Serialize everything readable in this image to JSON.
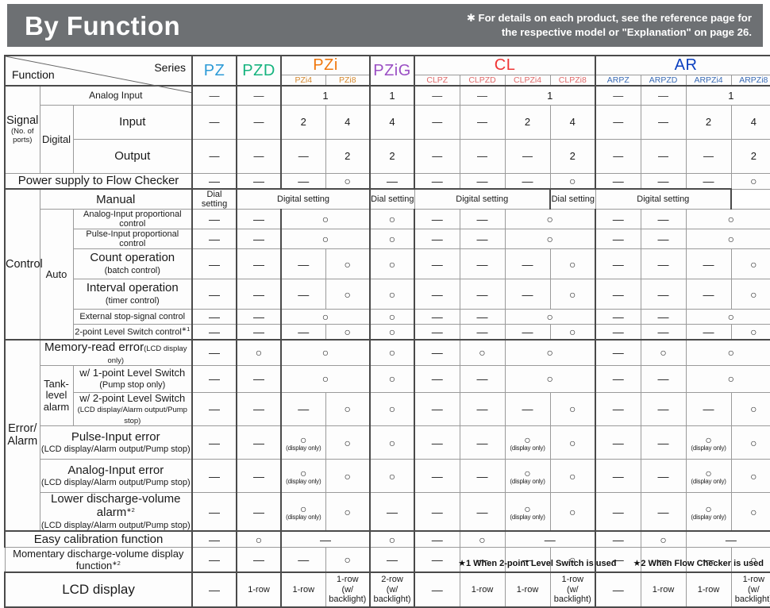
{
  "banner": {
    "title": "By Function",
    "note": "✱ For details on each product, see the reference page for\nthe respective model or \"Explanation\" on page 26."
  },
  "corner": {
    "series_label": "Series",
    "function_label": "Function"
  },
  "series_groups": [
    {
      "name": "PZ",
      "subs": []
    },
    {
      "name": "PZD",
      "subs": []
    },
    {
      "name": "PZi",
      "subs": [
        "PZi4",
        "PZi8"
      ]
    },
    {
      "name": "PZiG",
      "subs": []
    },
    {
      "name": "CL",
      "subs": [
        "CLPZ",
        "CLPZD",
        "CLPZi4",
        "CLPZi8"
      ]
    },
    {
      "name": "AR",
      "subs": [
        "ARPZ",
        "ARPZD",
        "ARPZi4",
        "ARPZi8"
      ]
    }
  ],
  "columns": [
    "PZ",
    "PZD",
    "PZi4",
    "PZi8",
    "PZiG",
    "CLPZ",
    "CLPZD",
    "CLPZi4",
    "CLPZi8",
    "ARPZ",
    "ARPZD",
    "ARPZi4",
    "ARPZi8"
  ],
  "rows": {
    "signal_group": "Signal",
    "signal_group_sub": "(No. of ports)",
    "digital_group": "Digital",
    "analog_input": "Analog Input",
    "digital_input": "Input",
    "digital_output": "Output",
    "power_supply": "Power supply to Flow Checker",
    "control_group": "Control",
    "manual": "Manual",
    "auto": "Auto",
    "analog_prop": "Analog-Input proportional control",
    "pulse_prop": "Pulse-Input proportional control",
    "count_op": "Count operation",
    "count_op_sub": "(batch control)",
    "interval_op": "Interval operation",
    "interval_op_sub": "(timer control)",
    "external_stop": "External stop-signal control",
    "two_point_level": "2-point Level Switch control",
    "two_point_level_sup": "∗1",
    "error_group": "Error/\nAlarm",
    "memory_read": "Memory-read error",
    "memory_read_sub": "(LCD display only)",
    "tank_level": "Tank-\nlevel\nalarm",
    "tank_1pt": "w/ 1-point Level Switch",
    "tank_1pt_sub": "(Pump stop only)",
    "tank_2pt": "w/ 2-point Level Switch",
    "tank_2pt_sub": "(LCD display/Alarm output/Pump stop)",
    "pulse_err": "Pulse-Input error",
    "pulse_err_sub": "(LCD display/Alarm output/Pump stop)",
    "analog_err": "Analog-Input error",
    "analog_err_sub": "(LCD display/Alarm output/Pump stop)",
    "lower_alarm": "Lower discharge-volume alarm",
    "lower_alarm_sup": "∗2",
    "lower_alarm_sub": "(LCD display/Alarm output/Pump stop)",
    "easy_cal": "Easy calibration function",
    "momentary": "Momentary discharge-volume display function",
    "momentary_sup": "∗2",
    "lcd_display": "LCD display"
  },
  "values": {
    "analog_input": {
      "PZ": "—",
      "PZD": "—",
      "PZi": "1",
      "PZiG": "1",
      "CLPZ": "—",
      "CLPZD": "—",
      "CLPZi": "1",
      "ARPZ": "—",
      "ARPZD": "—",
      "ARPZi": "1"
    },
    "digital_input": [
      "—",
      "—",
      "2",
      "4",
      "4",
      "—",
      "—",
      "2",
      "4",
      "—",
      "—",
      "2",
      "4"
    ],
    "digital_output": [
      "—",
      "—",
      "—",
      "2",
      "2",
      "—",
      "—",
      "—",
      "2",
      "—",
      "—",
      "—",
      "2"
    ],
    "power_supply": [
      "—",
      "—",
      "—",
      "○",
      "—",
      "—",
      "—",
      "—",
      "○",
      "—",
      "—",
      "—",
      "○"
    ],
    "manual": {
      "dial": "Dial setting",
      "digital": "Digital setting"
    },
    "analog_prop": {
      "PZ": "—",
      "PZD": "—",
      "PZi": "○",
      "PZiG": "○",
      "CLPZ": "—",
      "CLPZD": "—",
      "CLPZi": "○",
      "ARPZ": "—",
      "ARPZD": "—",
      "ARPZi": "○"
    },
    "pulse_prop": {
      "PZ": "—",
      "PZD": "—",
      "PZi": "○",
      "PZiG": "○",
      "CLPZ": "—",
      "CLPZD": "—",
      "CLPZi": "○",
      "ARPZ": "—",
      "ARPZD": "—",
      "ARPZi": "○"
    },
    "count_op": [
      "—",
      "—",
      "—",
      "○",
      "○",
      "—",
      "—",
      "—",
      "○",
      "—",
      "—",
      "—",
      "○"
    ],
    "interval_op": [
      "—",
      "—",
      "—",
      "○",
      "○",
      "—",
      "—",
      "—",
      "○",
      "—",
      "—",
      "—",
      "○"
    ],
    "external_stop": {
      "PZ": "—",
      "PZD": "—",
      "PZi": "○",
      "PZiG": "○",
      "CLPZ": "—",
      "CLPZD": "—",
      "CLPZi": "○",
      "ARPZ": "—",
      "ARPZD": "—",
      "ARPZi": "○"
    },
    "two_point_level": [
      "—",
      "—",
      "—",
      "○",
      "○",
      "—",
      "—",
      "—",
      "○",
      "—",
      "—",
      "—",
      "○"
    ],
    "memory_read": {
      "PZ": "—",
      "PZD": "○",
      "PZi": "○",
      "PZiG": "○",
      "CLPZ": "—",
      "CLPZD": "○",
      "CLPZi": "○",
      "ARPZ": "—",
      "ARPZD": "○",
      "ARPZi": "○"
    },
    "tank_1pt": {
      "PZ": "—",
      "PZD": "—",
      "PZi": "○",
      "PZiG": "○",
      "CLPZ": "—",
      "CLPZD": "—",
      "CLPZi": "○",
      "ARPZ": "—",
      "ARPZD": "—",
      "ARPZi": "○"
    },
    "tank_2pt": [
      "—",
      "—",
      "—",
      "○",
      "○",
      "—",
      "—",
      "—",
      "○",
      "—",
      "—",
      "—",
      "○"
    ],
    "pulse_err": [
      "—",
      "—",
      "○",
      "○",
      "○",
      "—",
      "—",
      "○",
      "○",
      "—",
      "—",
      "○",
      "○"
    ],
    "pulse_err_display_only": [
      "",
      "",
      "(display only)",
      "",
      "",
      "",
      "",
      "(display only)",
      "",
      "",
      "",
      "(display only)",
      ""
    ],
    "analog_err": [
      "—",
      "—",
      "○",
      "○",
      "○",
      "—",
      "—",
      "○",
      "○",
      "—",
      "—",
      "○",
      "○"
    ],
    "analog_err_display_only": [
      "",
      "",
      "(display only)",
      "",
      "",
      "",
      "",
      "(display only)",
      "",
      "",
      "",
      "(display only)",
      ""
    ],
    "lower_alarm": [
      "—",
      "—",
      "○",
      "○",
      "—",
      "—",
      "—",
      "○",
      "○",
      "—",
      "—",
      "○",
      "○"
    ],
    "lower_alarm_display_only": [
      "",
      "",
      "(display only)",
      "",
      "",
      "",
      "",
      "(display only)",
      "",
      "",
      "",
      "(display only)",
      ""
    ],
    "easy_cal": {
      "PZ": "—",
      "PZD": "○",
      "PZi": "—",
      "PZiG": "○",
      "CLPZ": "—",
      "CLPZD": "○",
      "CLPZi": "—",
      "ARPZ": "—",
      "ARPZD": "○",
      "ARPZi": "—"
    },
    "momentary": [
      "—",
      "—",
      "—",
      "○",
      "—",
      "—",
      "—",
      "—",
      "○",
      "—",
      "—",
      "—",
      "○"
    ],
    "lcd_display": [
      "—",
      "1-row",
      "1-row",
      "1-row",
      "2-row",
      "—",
      "1-row",
      "1-row",
      "1-row",
      "—",
      "1-row",
      "1-row",
      "1-row"
    ],
    "lcd_display_sub": [
      "",
      "",
      "",
      "(w/ backlight)",
      "(w/ backlight)",
      "",
      "",
      "",
      "(w/ backlight)",
      "",
      "",
      "",
      "(w/ backlight)"
    ]
  },
  "footnotes": {
    "fn1": "★1 When 2-point Level Switch is used",
    "fn2": "★2 When Flow Checker is used"
  },
  "colors": {
    "banner_bg": "#6d7073",
    "pz": "#2d9bd7",
    "pzd": "#15b37e",
    "pzi": "#f0770d",
    "pzig": "#9a4fc4",
    "cl": "#f03535",
    "ar": "#0a3fc0"
  }
}
